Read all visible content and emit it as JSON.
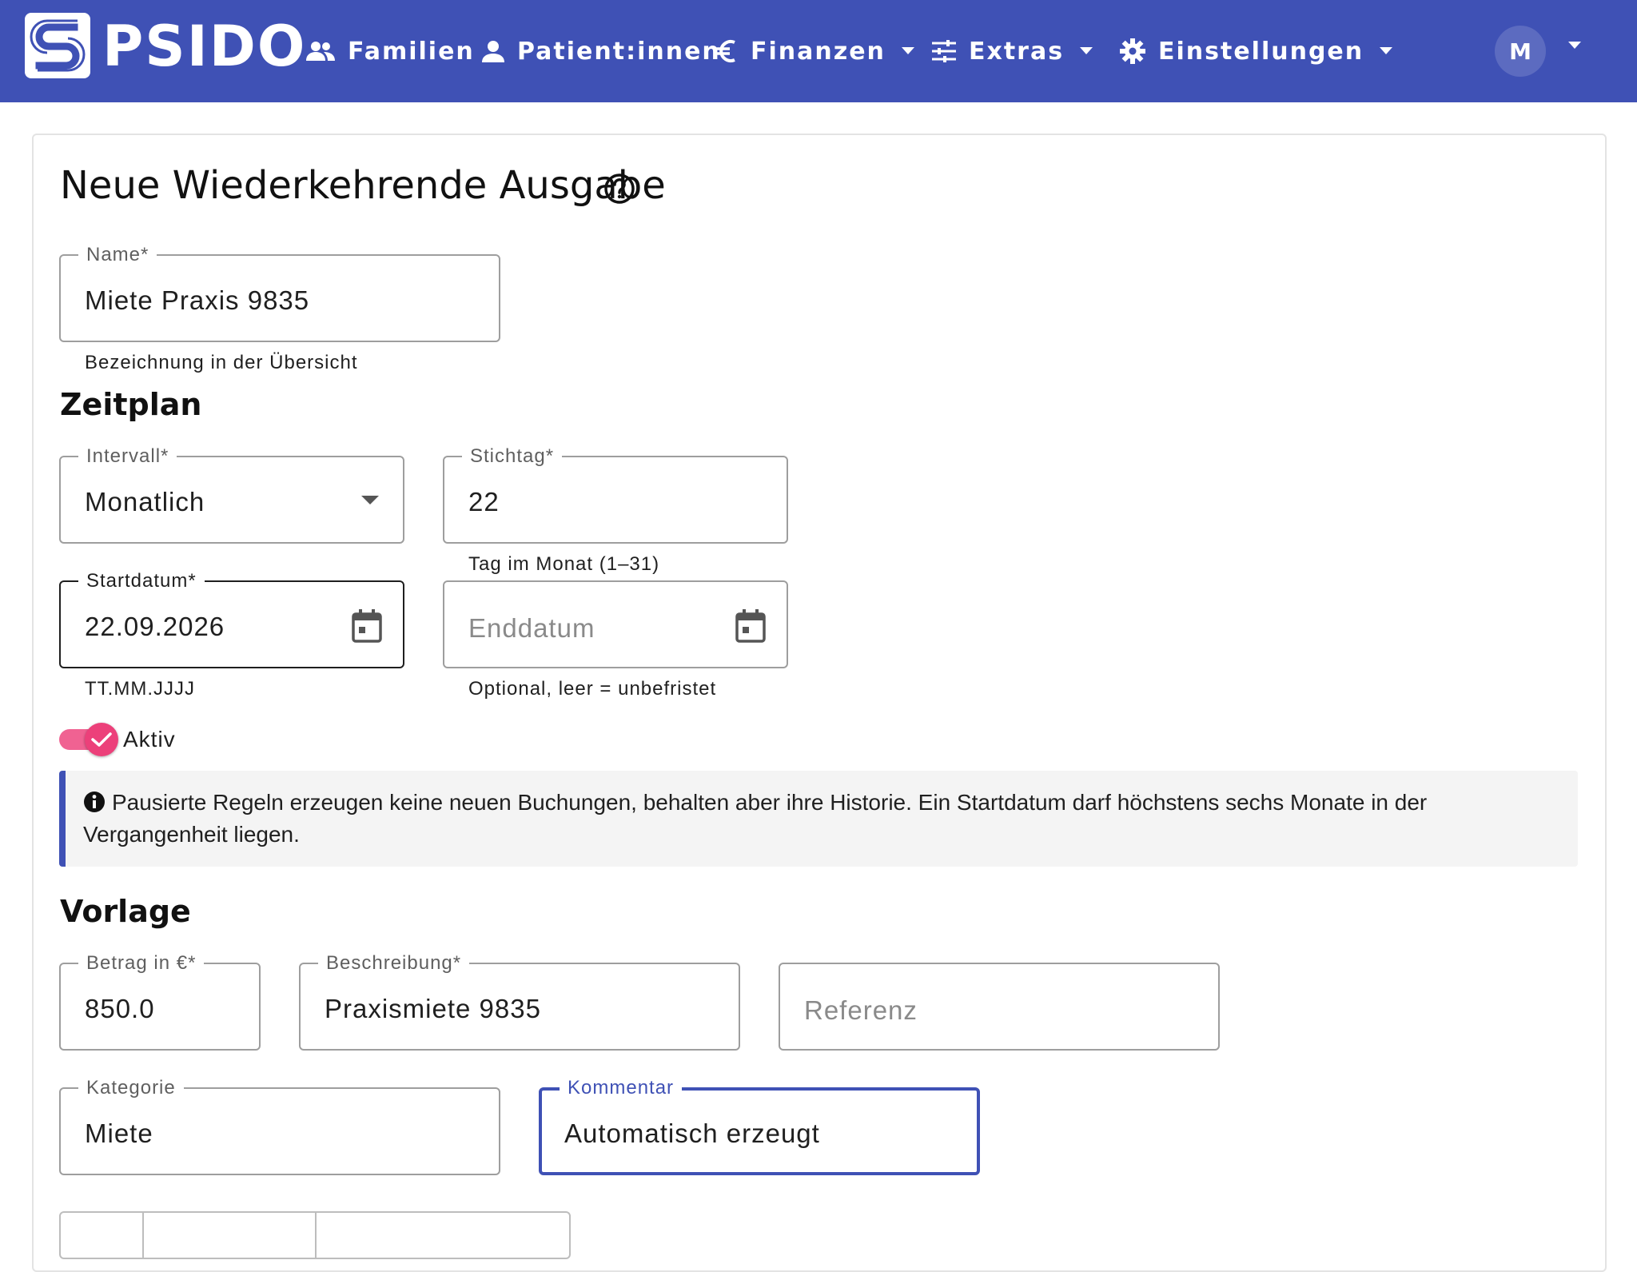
{
  "nav": {
    "brand": "PSIDO",
    "items": [
      {
        "label": "Familien",
        "icon": "people-icon"
      },
      {
        "label": "Patient:innen",
        "icon": "person-icon"
      },
      {
        "label": "Finanzen",
        "icon": "euro-icon"
      },
      {
        "label": "Extras",
        "icon": "tune-icon"
      },
      {
        "label": "Einstellungen",
        "icon": "gear-icon"
      }
    ],
    "avatar_initial": "M"
  },
  "page": {
    "title": "Neue Wiederkehrende Ausgabe"
  },
  "form": {
    "name": {
      "label": "Name*",
      "value": "Miete Praxis 9835",
      "hint": "Bezeichnung in der Übersicht"
    },
    "schedule_title": "Zeitplan",
    "interval": {
      "label": "Intervall*",
      "value": "Monatlich"
    },
    "due_day": {
      "label": "Stichtag*",
      "value": "22",
      "hint": "Tag im Monat (1–31)"
    },
    "start_date": {
      "label": "Startdatum*",
      "value": "22.09.2026",
      "hint": "TT.MM.JJJJ"
    },
    "end_date": {
      "placeholder": "Enddatum",
      "hint": "Optional, leer = unbefristet"
    },
    "active": {
      "label": "Aktiv",
      "checked": true
    },
    "info_text": "Pausierte Regeln erzeugen keine neuen Buchungen, behalten aber ihre Historie. Ein Startdatum darf höchstens sechs Monate in der Vergangenheit liegen.",
    "template_title": "Vorlage",
    "amount": {
      "label": "Betrag in €*",
      "value": "850.0"
    },
    "description": {
      "label": "Beschreibung*",
      "value": "Praxismiete 9835"
    },
    "reference": {
      "placeholder": "Referenz"
    },
    "category": {
      "label": "Kategorie",
      "value": "Miete"
    },
    "comment": {
      "label": "Kommentar",
      "value": "Automatisch erzeugt"
    }
  },
  "colors": {
    "primary": "#3f51b5",
    "toggle_accent": "#ec407a",
    "info_bg": "#f4f4f4"
  }
}
